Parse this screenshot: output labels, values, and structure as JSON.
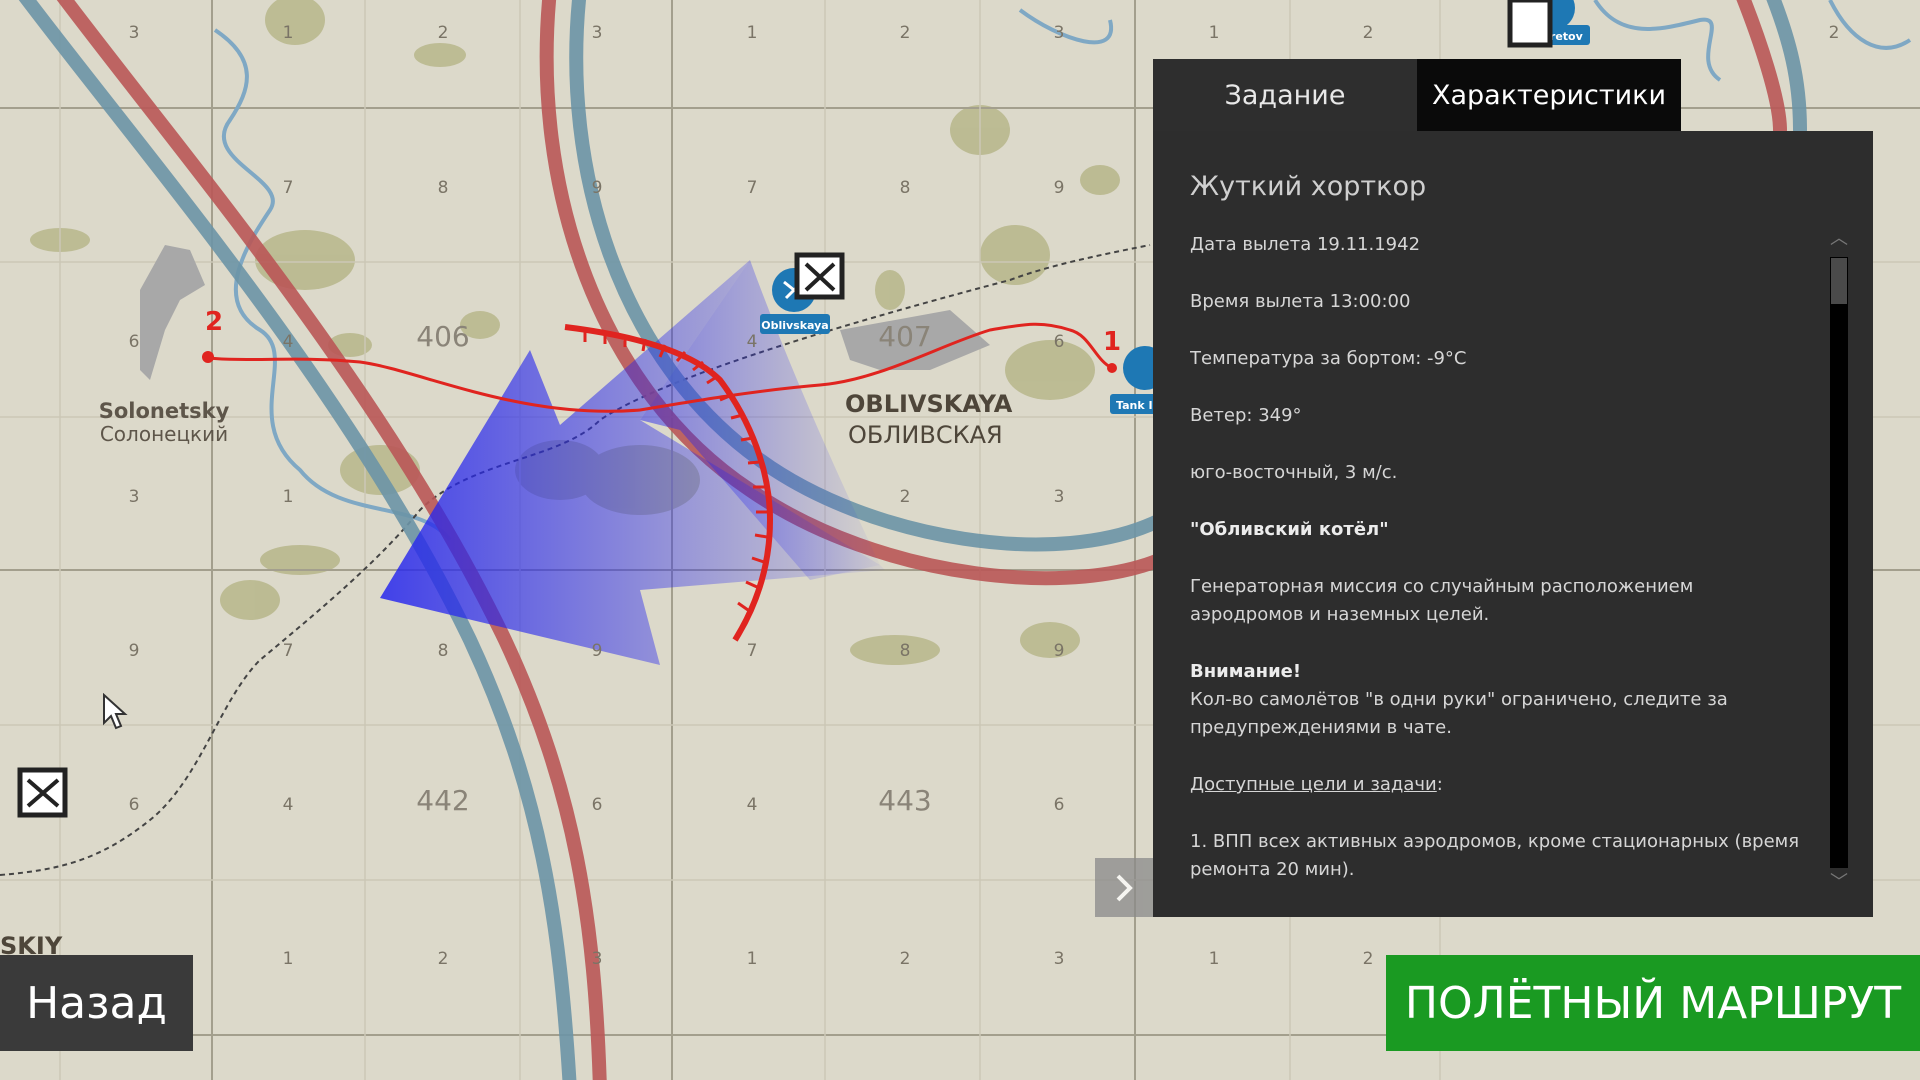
{
  "map": {
    "square_labels": [
      "406",
      "407",
      "442",
      "443"
    ],
    "places": {
      "solonetsky_latin": "Solonetsky",
      "solonetsky_cyr": "Солонецкий",
      "oblivskaya_latin": "OBLIVSKAYA",
      "oblivskaya_cyr": "ОБЛИВСКАЯ",
      "skiy_partial": "SKIY"
    },
    "markers": {
      "oblivskaya_airfield": "Oblivskaya",
      "sekretov_airfield": "Sekretov",
      "tank_partial": "Tank I"
    },
    "waypoints": {
      "start": "1",
      "end": "2"
    }
  },
  "tabs": {
    "task": "Задание",
    "specs": "Характеристики"
  },
  "panel": {
    "title": "Жуткий хорткор",
    "lines": {
      "departure_date": "Дата вылета 19.11.1942",
      "departure_time": "Время вылета 13:00:00",
      "temperature": "Температура за бортом: -9°C",
      "wind": "Ветер: 349°",
      "wind_dir": "юго-восточный, 3 м/с.",
      "mission_name": "\"Обливский котёл\"",
      "description": "Генераторная миссия со случайным расположением аэродромов и наземных целей.",
      "warning_title": "Внимание!",
      "warning_text": "Кол-во самолётов \"в одни руки\" ограничено, следите за предупреждениями в чате.",
      "targets_header": "Доступные цели и задачи",
      "targets_colon": ":",
      "target_1": "1. ВПП всех активных аэродромов, кроме стационарных (время ремонта 20 мин)."
    }
  },
  "buttons": {
    "back": "Назад",
    "flight_route": "ПОЛЁТНЫЙ МАРШРУТ"
  },
  "colors": {
    "route_red": "#e0241f",
    "front_blue": "#2222ee",
    "button_green": "#1a9a22",
    "panel_bg": "#2d2d2d"
  }
}
